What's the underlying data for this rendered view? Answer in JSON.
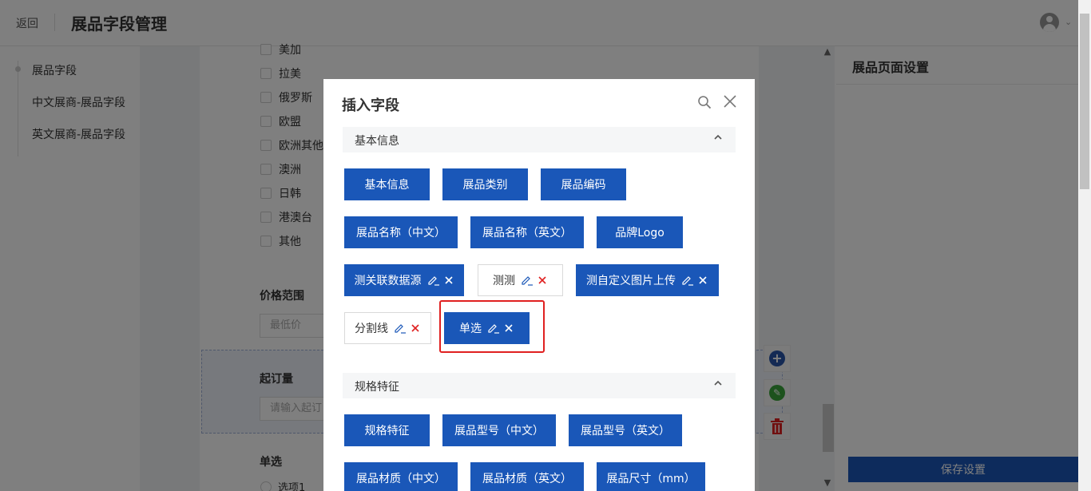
{
  "header": {
    "back_label": "返回",
    "title": "展品字段管理"
  },
  "sidebar": {
    "items": [
      {
        "label": "展品字段"
      },
      {
        "label": "中文展商-展品字段"
      },
      {
        "label": "英文展商-展品字段"
      }
    ]
  },
  "form": {
    "regions": [
      "美加",
      "拉美",
      "俄罗斯",
      "欧盟",
      "欧洲其他",
      "澳洲",
      "日韩",
      "港澳台",
      "其他"
    ],
    "price_label": "价格范围",
    "price_placeholder": "最低价",
    "moq_label": "起订量",
    "moq_placeholder": "请输入起订",
    "single_label": "单选",
    "option1": "选项1"
  },
  "right_panel": {
    "title": "展品页面设置",
    "save_label": "保存设置"
  },
  "modal": {
    "title": "插入字段",
    "groups": [
      {
        "title": "基本信息",
        "chips": [
          {
            "label": "基本信息"
          },
          {
            "label": "展品类别"
          },
          {
            "label": "展品编码"
          },
          {
            "label": "展品名称（中文）"
          },
          {
            "label": "展品名称（英文）"
          },
          {
            "label": "品牌Logo"
          },
          {
            "label": "测关联数据源"
          },
          {
            "label": "测测"
          },
          {
            "label": "测自定义图片上传"
          },
          {
            "label": "分割线"
          },
          {
            "label": "单选"
          }
        ]
      },
      {
        "title": "规格特征",
        "chips": [
          {
            "label": "规格特征"
          },
          {
            "label": "展品型号（中文）"
          },
          {
            "label": "展品型号（英文）"
          },
          {
            "label": "展品材质（中文）"
          },
          {
            "label": "展品材质（英文）"
          },
          {
            "label": "展品尺寸（mm）"
          }
        ]
      }
    ]
  },
  "colors": {
    "primary": "#1a57b8",
    "danger": "#e02020",
    "highlight": "#e02020"
  }
}
